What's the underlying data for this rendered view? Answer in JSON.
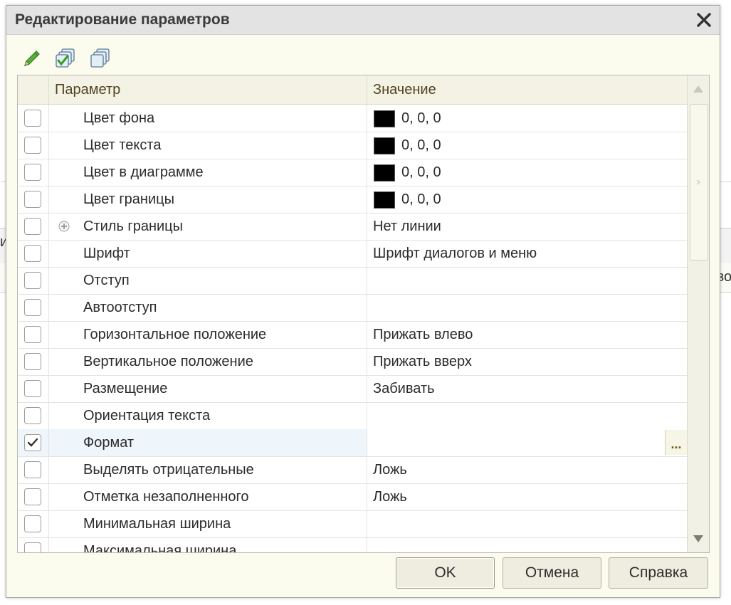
{
  "background": {
    "left_fragment": "и",
    "right_fragment": "зо"
  },
  "dialog": {
    "title": "Редактирование параметров",
    "close_icon": "close-icon",
    "toolbar": [
      {
        "name": "edit-pencil-button",
        "icon": "pencil-icon"
      },
      {
        "name": "check-all-button",
        "icon": "check-all-icon"
      },
      {
        "name": "uncheck-all-button",
        "icon": "uncheck-all-icon"
      }
    ],
    "grid": {
      "columns": {
        "parameter": "Параметр",
        "value": "Значение"
      },
      "rows": [
        {
          "checked": false,
          "name": "Цвет фона",
          "value": "0, 0, 0",
          "swatch": "#000000"
        },
        {
          "checked": false,
          "name": "Цвет текста",
          "value": "0, 0, 0",
          "swatch": "#000000"
        },
        {
          "checked": false,
          "name": "Цвет в диаграмме",
          "value": "0, 0, 0",
          "swatch": "#000000"
        },
        {
          "checked": false,
          "name": "Цвет границы",
          "value": "0, 0, 0",
          "swatch": "#000000"
        },
        {
          "checked": false,
          "name": "Стиль границы",
          "value": "Нет линии",
          "expandable": true
        },
        {
          "checked": false,
          "name": "Шрифт",
          "value": "Шрифт диалогов и меню"
        },
        {
          "checked": false,
          "name": "Отступ",
          "value": ""
        },
        {
          "checked": false,
          "name": "Автоотступ",
          "value": ""
        },
        {
          "checked": false,
          "name": "Горизонтальное положение",
          "value": "Прижать влево"
        },
        {
          "checked": false,
          "name": "Вертикальное положение",
          "value": "Прижать вверх"
        },
        {
          "checked": false,
          "name": "Размещение",
          "value": "Забивать"
        },
        {
          "checked": false,
          "name": "Ориентация текста",
          "value": ""
        },
        {
          "checked": true,
          "name": "Формат",
          "value": "",
          "selected": true,
          "ellipsis": "..."
        },
        {
          "checked": false,
          "name": "Выделять отрицательные",
          "value": "Ложь"
        },
        {
          "checked": false,
          "name": "Отметка незаполненного",
          "value": "Ложь"
        },
        {
          "checked": false,
          "name": "Минимальная ширина",
          "value": ""
        },
        {
          "checked": false,
          "name": "Максимальная ширина",
          "value": ""
        }
      ]
    },
    "buttons": {
      "ok": "OK",
      "cancel": "Отмена",
      "help": "Справка"
    }
  },
  "colors": {
    "dialog_bg": "#fbfbee",
    "header_bg": "#f4f2e4",
    "selected_row": "#eef5fb",
    "swatch": "#000000"
  }
}
